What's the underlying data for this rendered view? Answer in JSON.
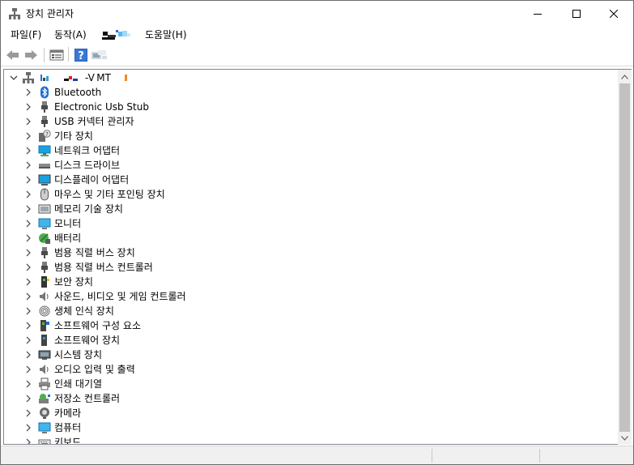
{
  "window": {
    "title": "장치 관리자"
  },
  "menu": {
    "file": "파일(F)",
    "action": "동작(A)",
    "help": "도움말(H)"
  },
  "tree": {
    "root_label": "-V MT",
    "items": [
      {
        "label": "Bluetooth",
        "icon": "bluetooth-icon"
      },
      {
        "label": "Electronic Usb Stub",
        "icon": "usb-plug-icon"
      },
      {
        "label": "USB 커넥터 관리자",
        "icon": "usb-plug-icon"
      },
      {
        "label": "기타 장치",
        "icon": "unknown-device-icon"
      },
      {
        "label": "네트워크 어댑터",
        "icon": "network-adapter-icon"
      },
      {
        "label": "디스크 드라이브",
        "icon": "disk-drive-icon"
      },
      {
        "label": "디스플레이 어댑터",
        "icon": "display-adapter-icon"
      },
      {
        "label": "마우스 및 기타 포인팅 장치",
        "icon": "mouse-icon"
      },
      {
        "label": "메모리 기술 장치",
        "icon": "memory-device-icon"
      },
      {
        "label": "모니터",
        "icon": "monitor-icon"
      },
      {
        "label": "배터리",
        "icon": "battery-icon"
      },
      {
        "label": "범용 직렬 버스 장치",
        "icon": "usb-plug-icon"
      },
      {
        "label": "범용 직렬 버스 컨트롤러",
        "icon": "usb-plug-icon"
      },
      {
        "label": "보안 장치",
        "icon": "security-device-icon"
      },
      {
        "label": "사운드, 비디오 및 게임 컨트롤러",
        "icon": "speaker-icon"
      },
      {
        "label": "생체 인식 장치",
        "icon": "fingerprint-icon"
      },
      {
        "label": "소프트웨어 구성 요소",
        "icon": "software-component-icon"
      },
      {
        "label": "소프트웨어 장치",
        "icon": "software-device-icon"
      },
      {
        "label": "시스템 장치",
        "icon": "system-device-icon"
      },
      {
        "label": "오디오 입력 및 출력",
        "icon": "speaker-icon"
      },
      {
        "label": "인쇄 대기열",
        "icon": "printer-icon"
      },
      {
        "label": "저장소 컨트롤러",
        "icon": "storage-controller-icon"
      },
      {
        "label": "카메라",
        "icon": "camera-icon"
      },
      {
        "label": "컴퓨터",
        "icon": "computer-icon"
      },
      {
        "label": "키보드",
        "icon": "keyboard-icon"
      }
    ]
  },
  "colors": {
    "accent_blue": "#1e6fd9",
    "usb_gray": "#555555",
    "monitor_blue": "#1ba1e2",
    "scroll_thumb": "#c1c1c1"
  }
}
